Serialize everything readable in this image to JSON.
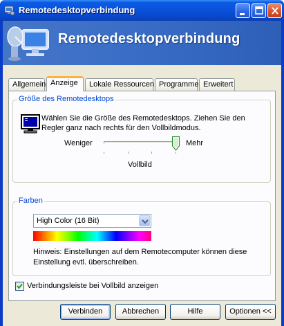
{
  "window": {
    "title": "Remotedesktopverbindung",
    "icon": "remote-desktop-icon",
    "controls": {
      "minimize": "minimize-icon",
      "maximize": "maximize-icon",
      "close": "close-icon"
    }
  },
  "banner": {
    "title": "Remotedesktopverbindung",
    "art": "remote-desktop-illustration"
  },
  "tabs": [
    {
      "label": "Allgemein",
      "active": false
    },
    {
      "label": "Anzeige",
      "active": true
    },
    {
      "label": "Lokale Ressourcen",
      "active": false
    },
    {
      "label": "Programme",
      "active": false
    },
    {
      "label": "Erweitert",
      "active": false
    }
  ],
  "display_size": {
    "group_title": "Größe des Remotedesktops",
    "icon": "monitor-icon",
    "description": "Wählen Sie die Größe des Remotedesktops. Ziehen Sie den Regler ganz nach rechts für den Vollbildmodus.",
    "slider": {
      "min_label": "Weniger",
      "max_label": "Mehr",
      "value_label": "Vollbild",
      "position_fraction": 1.0
    }
  },
  "colors": {
    "group_title": "Farben",
    "selected": "High Color (16 Bit)",
    "hint": "Hinweis: Einstellungen auf dem Remotecomputer können diese Einstellung evtl. überschreiben."
  },
  "connection_bar": {
    "label": "Verbindungsleiste bei Vollbild anzeigen",
    "checked": true
  },
  "buttons": {
    "connect": "Verbinden",
    "cancel": "Abbrechen",
    "help": "Hilfe",
    "options": "Optionen <<"
  },
  "theme": {
    "accent": "#0a5ce6",
    "tab_highlight": "#f7b444",
    "group_title_color": "#0046d5"
  }
}
